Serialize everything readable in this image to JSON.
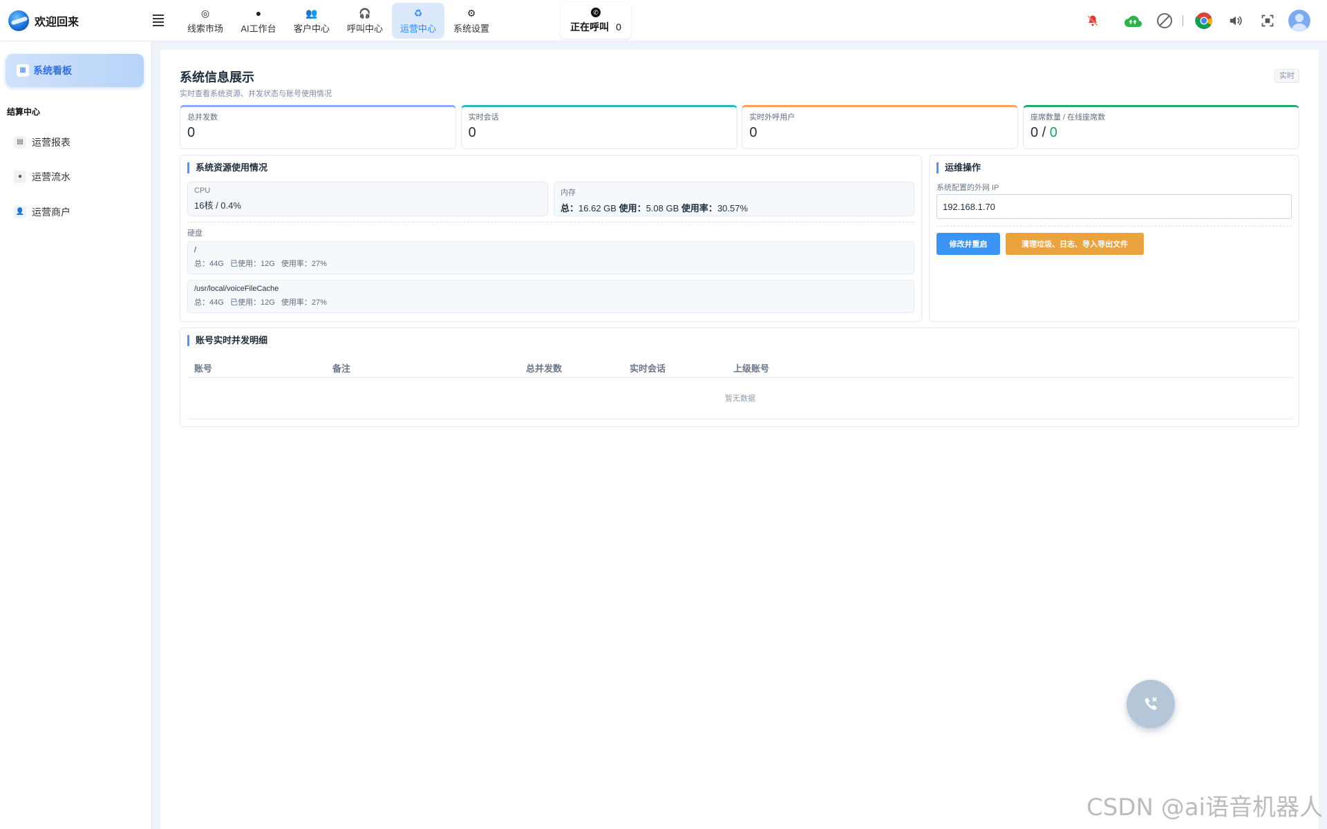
{
  "header": {
    "title": "欢迎回来",
    "nav": [
      {
        "label": "线索市场",
        "icon": "target-icon"
      },
      {
        "label": "AI工作台",
        "icon": "robot-icon"
      },
      {
        "label": "客户中心",
        "icon": "users-icon"
      },
      {
        "label": "呼叫中心",
        "icon": "headset-icon"
      },
      {
        "label": "运营中心",
        "icon": "recycle-icon",
        "active": true
      },
      {
        "label": "系统设置",
        "icon": "gear-icon"
      }
    ],
    "calling": {
      "label": "正在呼叫",
      "count": "0"
    },
    "tools": [
      "bell-muted-icon",
      "cloud-upload-icon",
      "ban-icon",
      "chrome-icon",
      "volume-icon",
      "fullscreen-icon",
      "avatar"
    ]
  },
  "sidebar": {
    "active_item": {
      "label": "系统看板",
      "icon": "dashboard-icon"
    },
    "group": "结算中心",
    "items": [
      {
        "label": "运营报表",
        "icon": "table-icon"
      },
      {
        "label": "运营流水",
        "icon": "drop-icon"
      },
      {
        "label": "运营商户",
        "icon": "merchant-icon"
      }
    ]
  },
  "page": {
    "title": "系统信息展示",
    "subtitle": "实时查看系统资源、并发状态与账号使用情况",
    "badge": "实时"
  },
  "stats": [
    {
      "label": "总并发数",
      "value": "0",
      "accent": "#8da8ff"
    },
    {
      "label": "实时会话",
      "value": "0",
      "accent": "#2fb4c8"
    },
    {
      "label": "实时外呼用户",
      "value": "0",
      "accent": "#f6a05c"
    },
    {
      "label": "座席数量 / 在线座席数",
      "value_a": "0",
      "value_sep": " / ",
      "value_b": "0",
      "accent": "#2aa86a"
    }
  ],
  "resources": {
    "title": "系统资源使用情况",
    "cpu": {
      "label": "CPU",
      "value": "16核 / 0.4%"
    },
    "memory": {
      "label": "内存",
      "total_label": "总：",
      "total": "16.62 GB",
      "used_label": "使用：",
      "used": "5.08 GB",
      "rate_label": "使用率：",
      "rate": "30.57%"
    },
    "disk_label": "硬盘",
    "disks": [
      {
        "path": "/",
        "detail": "总：44G   已使用：12G   使用率：27%"
      },
      {
        "path": "/usr/local/voiceFileCache",
        "detail": "总：44G   已使用：12G   使用率：27%"
      }
    ]
  },
  "ops": {
    "title": "运维操作",
    "ip_label": "系统配置的外网 IP",
    "ip_value": "192.168.1.70",
    "btn_restart": "修改并重启",
    "btn_clean": "清理垃圾、日志、导入导出文件"
  },
  "detail": {
    "title": "账号实时并发明细",
    "columns": [
      "账号",
      "备注",
      "总并发数",
      "实时会话",
      "上级账号"
    ],
    "empty": "暂无数据"
  },
  "watermark": "CSDN @ai语音机器人",
  "colors": {
    "accent": "#2f86f6",
    "warning": "#eba33f",
    "primary_btn": "#3c94f5"
  }
}
